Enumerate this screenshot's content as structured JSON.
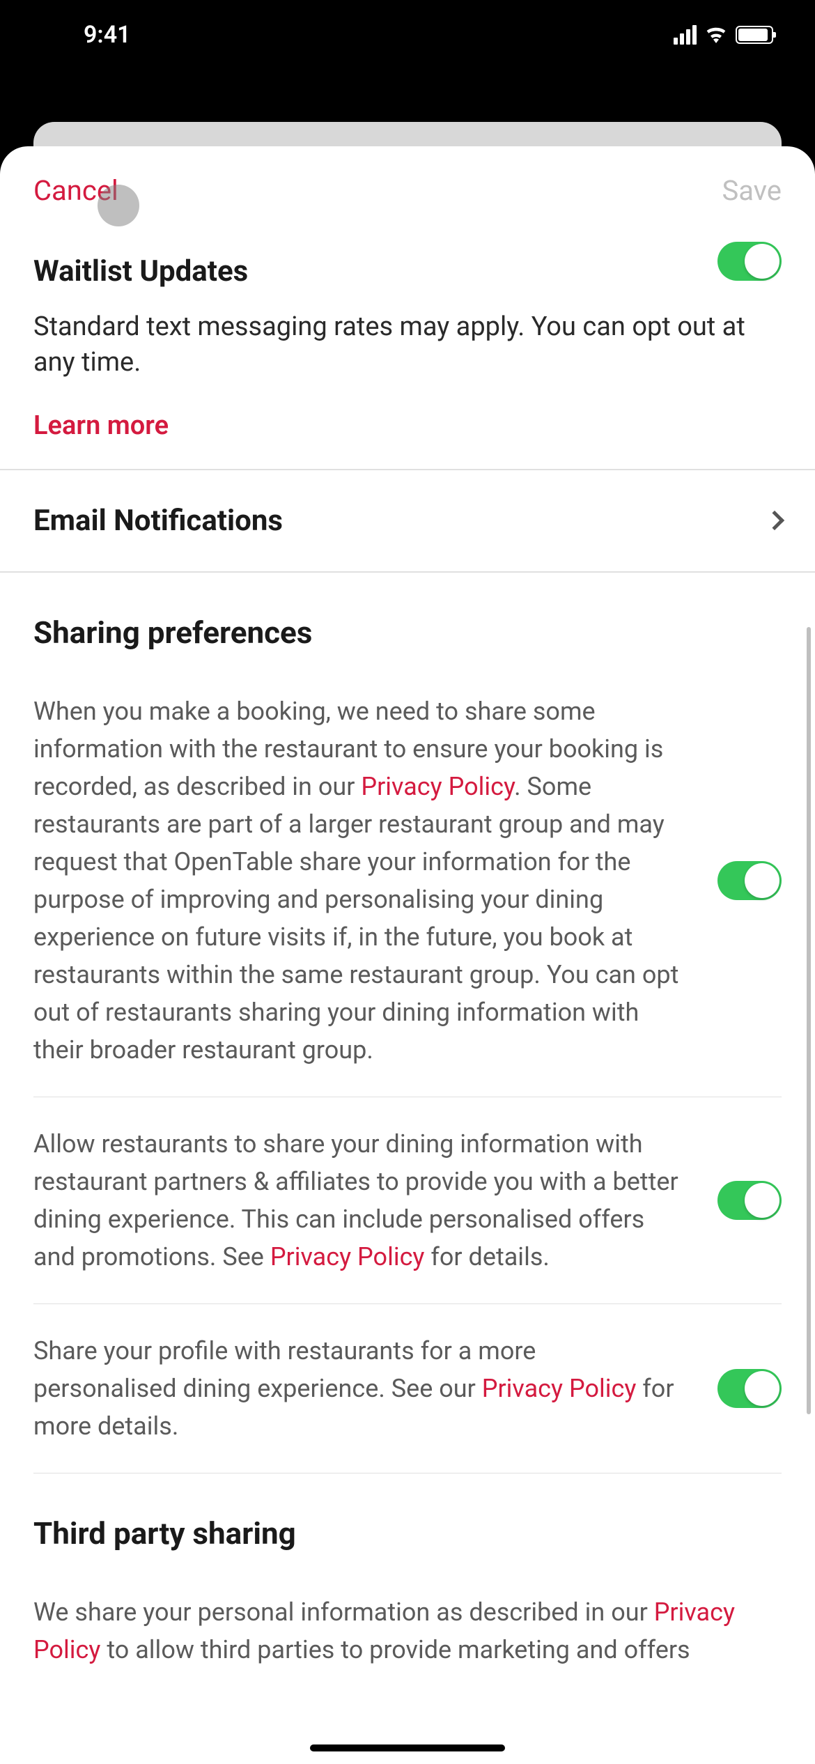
{
  "status": {
    "time": "9:41"
  },
  "header": {
    "cancel": "Cancel",
    "save": "Save"
  },
  "waitlist": {
    "title": "Waitlist Updates",
    "description": "Standard text messaging rates may apply. You can opt out at any time.",
    "learnMore": "Learn more"
  },
  "emailNotifications": {
    "title": "Email Notifications"
  },
  "sharing": {
    "title": "Sharing preferences",
    "item1_pre": "When you make a booking, we need to share some information with the restaurant to ensure your booking is recorded, as described in our ",
    "item1_link": "Privacy Policy",
    "item1_post": ". Some restaurants are part of a larger restaurant group and may request that OpenTable share your information for the purpose of improving and personalising your dining experience on future visits if, in the future, you book at restaurants within the same restaurant group. You can opt out of restaurants sharing your dining information with their broader restaurant group.",
    "item2_pre": "Allow restaurants to share your dining information with restaurant partners & affiliates to provide you with a better dining experience. This can include personalised offers and promotions. See ",
    "item2_link": "Privacy Policy",
    "item2_post": " for details.",
    "item3_pre": "Share your profile with restaurants for a more personalised dining experience. See our ",
    "item3_link": "Privacy Policy",
    "item3_post": " for more details."
  },
  "thirdParty": {
    "title": "Third party sharing",
    "text_pre": "We share your personal information as described in our ",
    "text_link": "Privacy Policy",
    "text_post": " to allow third parties to provide marketing and offers"
  }
}
